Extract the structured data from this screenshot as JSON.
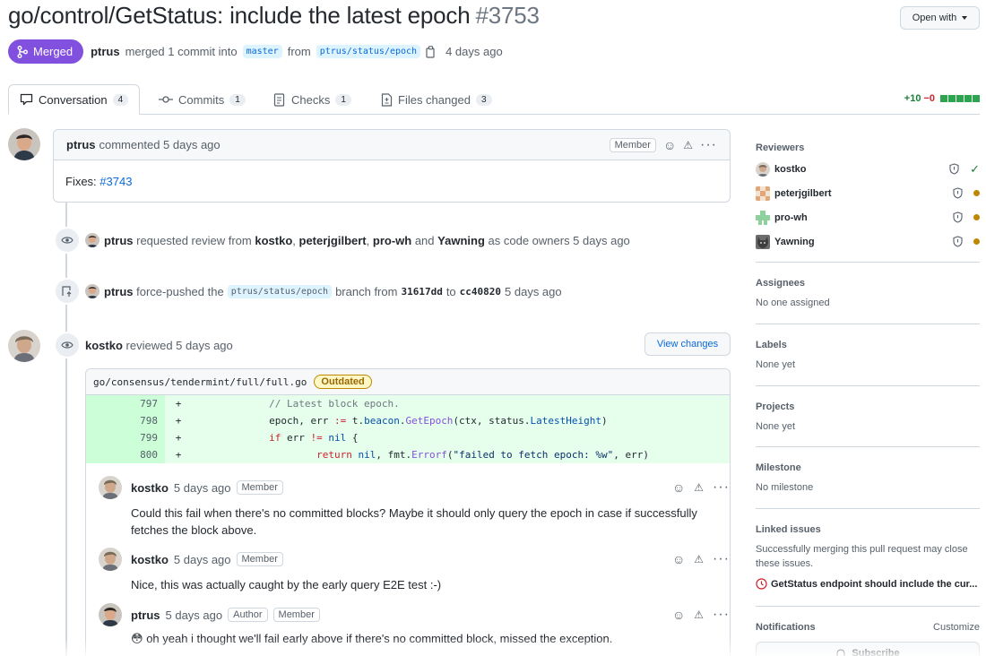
{
  "pr": {
    "title": "go/control/GetStatus: include the latest epoch",
    "number": "#3753",
    "open_with": "Open with",
    "status": "Merged",
    "author": "ptrus",
    "merged_text": "merged 1 commit into",
    "base_branch": "master",
    "from_text": "from",
    "head_branch": "ptrus/status/epoch",
    "time": "4 days ago"
  },
  "tabs": [
    {
      "label": "Conversation",
      "count": "4"
    },
    {
      "label": "Commits",
      "count": "1"
    },
    {
      "label": "Checks",
      "count": "1"
    },
    {
      "label": "Files changed",
      "count": "3"
    }
  ],
  "diffstat": {
    "additions": "+10",
    "deletions": "−0"
  },
  "first_comment": {
    "author": "ptrus",
    "action": "commented 5 days ago",
    "role": "Member",
    "body_prefix": "Fixes:",
    "body_link": "#3743"
  },
  "events": {
    "review_request": {
      "actor": "ptrus",
      "text1": "requested review from",
      "r1": "kostko",
      "r2": "peterjgilbert",
      "r3": "pro-wh",
      "and": "and",
      "r4": "Yawning",
      "text2": "as code owners 5 days ago"
    },
    "force_push": {
      "actor": "ptrus",
      "text1": "force-pushed the",
      "branch": "ptrus/status/epoch",
      "text2": "branch from",
      "from_sha": "31617dd",
      "to": "to",
      "to_sha": "cc40820",
      "time": "5 days ago"
    },
    "review": {
      "actor": "kostko",
      "text": "reviewed 5 days ago",
      "view_changes": "View changes"
    }
  },
  "diff": {
    "file": "go/consensus/tendermint/full/full.go",
    "badge": "Outdated",
    "lines": [
      {
        "num": "797",
        "sign": "+"
      },
      {
        "num": "798",
        "sign": "+"
      },
      {
        "num": "799",
        "sign": "+"
      },
      {
        "num": "800",
        "sign": "+"
      }
    ],
    "code": {
      "l1_comment": "// Latest block epoch.",
      "l2_a": "epoch, err ",
      "l2_op": ":=",
      "l2_b": " t.",
      "l2_c": "beacon",
      "l2_d": ".",
      "l2_e": "GetEpoch",
      "l2_f": "(ctx, status.",
      "l2_g": "LatestHeight",
      "l2_h": ")",
      "l3_kw": "if",
      "l3_a": " err ",
      "l3_op": "!=",
      "l3_nil": " nil",
      "l3_b": " {",
      "l4_kw": "return",
      "l4_nil": " nil",
      "l4_a": ", fmt.",
      "l4_fn": "Errorf",
      "l4_b": "(",
      "l4_str": "\"failed to fetch epoch: %w\"",
      "l4_c": ", err)"
    }
  },
  "review_comments": [
    {
      "author": "kostko",
      "time": "5 days ago",
      "roles": [
        "Member"
      ],
      "body": "Could this fail when there's no committed blocks? Maybe it should only query the epoch in case if successfully fetches the block above."
    },
    {
      "author": "kostko",
      "time": "5 days ago",
      "roles": [
        "Member"
      ],
      "body": "Nice, this was actually caught by the early query E2E test :-)"
    },
    {
      "author": "ptrus",
      "time": "5 days ago",
      "roles": [
        "Author",
        "Member"
      ],
      "body": "oh yeah i thought we'll fail early above if there's no committed block, missed the exception.",
      "emoji": "😳"
    }
  ],
  "sidebar": {
    "reviewers_title": "Reviewers",
    "reviewers": [
      {
        "name": "kostko",
        "state": "approved"
      },
      {
        "name": "peterjgilbert",
        "state": "pending"
      },
      {
        "name": "pro-wh",
        "state": "pending"
      },
      {
        "name": "Yawning",
        "state": "pending"
      }
    ],
    "assignees_title": "Assignees",
    "assignees_value": "No one assigned",
    "labels_title": "Labels",
    "labels_value": "None yet",
    "projects_title": "Projects",
    "projects_value": "None yet",
    "milestone_title": "Milestone",
    "milestone_value": "No milestone",
    "linked_title": "Linked issues",
    "linked_desc": "Successfully merging this pull request may close these issues.",
    "linked_issue": "GetStatus endpoint should include the cur...",
    "notifications_title": "Notifications",
    "customize": "Customize",
    "subscribe": "Subscribe"
  },
  "colors": {
    "merged": "#8250df",
    "link": "#0969da",
    "add": "#1a7f37",
    "pending": "#bf8700"
  }
}
